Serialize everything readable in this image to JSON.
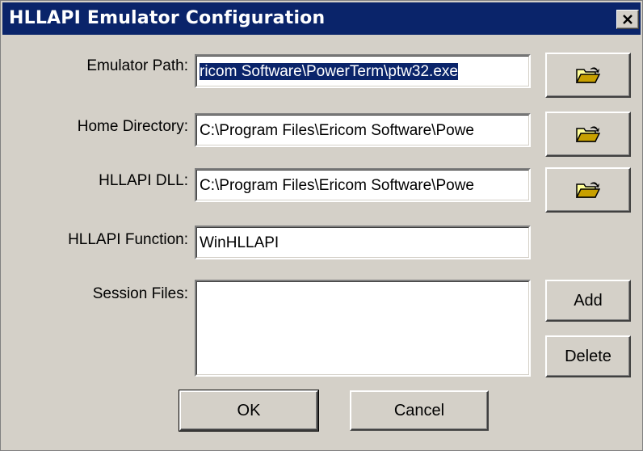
{
  "window": {
    "title": "HLLAPI Emulator Configuration"
  },
  "fields": {
    "emulator_path": {
      "label": "Emulator Path:",
      "value": "ricom Software\\PowerTerm\\ptw32.exe"
    },
    "home_directory": {
      "label": "Home Directory:",
      "value": "C:\\Program Files\\Ericom Software\\Powe"
    },
    "hllapi_dll": {
      "label": "HLLAPI DLL:",
      "value": "C:\\Program Files\\Ericom Software\\Powe"
    },
    "hllapi_function": {
      "label": "HLLAPI Function:",
      "value": "WinHLLAPI"
    },
    "session_files": {
      "label": "Session Files:",
      "items": []
    }
  },
  "buttons": {
    "add": "Add",
    "delete": "Delete",
    "ok": "OK",
    "cancel": "Cancel"
  },
  "icons": {
    "browse": "open-folder-icon",
    "close": "close-icon"
  },
  "colors": {
    "titlebar": "#0a246a",
    "dialog": "#d4d0c8",
    "selection": "#0a246a"
  }
}
